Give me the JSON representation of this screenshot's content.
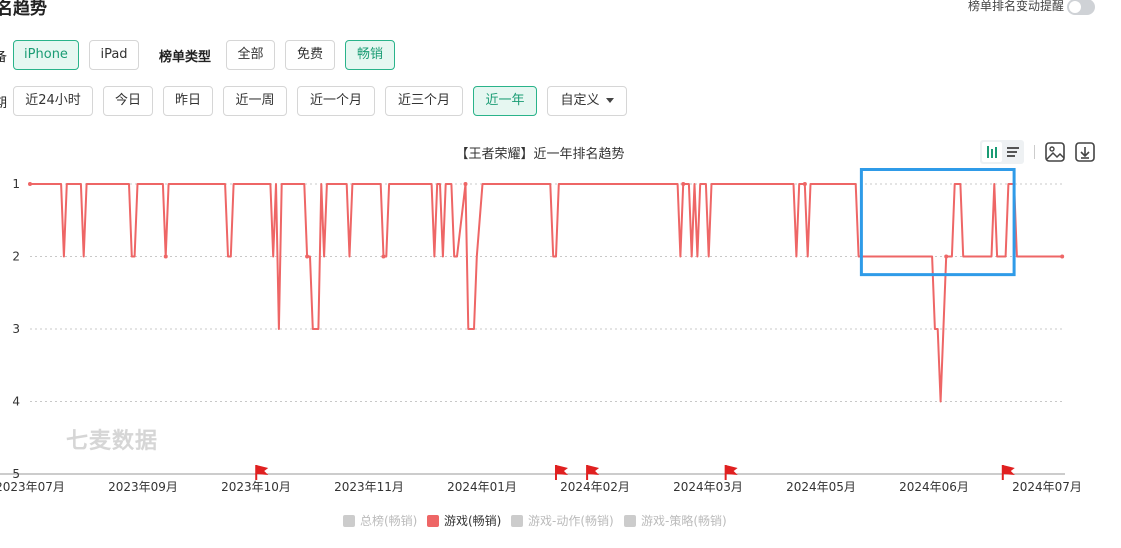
{
  "header": {
    "title": "名趋势",
    "toggle_label": "榜单排名变动提醒"
  },
  "filters": {
    "device_label": "备",
    "device_options": [
      "iPhone",
      "iPad"
    ],
    "device_selected": "iPhone",
    "chart_type_label": "榜单类型",
    "chart_type_options": [
      "全部",
      "免费",
      "畅销"
    ],
    "chart_type_selected": "畅销",
    "time_label": "期",
    "time_options": [
      "近24小时",
      "今日",
      "昨日",
      "近一周",
      "近一个月",
      "近三个月",
      "近一年"
    ],
    "time_selected": "近一年",
    "custom_label": "自定义"
  },
  "chart_data": {
    "type": "line",
    "title": "【王者荣耀】近一年排名趋势",
    "y_axis": {
      "inverted": true,
      "min": 1,
      "max": 5,
      "ticks": [
        "1",
        "2",
        "3",
        "4",
        "5"
      ]
    },
    "x_axis": {
      "range": [
        "2023-07-01",
        "2024-07-01"
      ],
      "tick_labels": [
        "2023年07月",
        "2023年09月",
        "2023年10月",
        "2023年11月",
        "2024年01月",
        "2024年02月",
        "2024年03月",
        "2024年05月",
        "2024年06月",
        "2024年07月"
      ]
    },
    "grid": "horizontal-dotted",
    "legend_position": "bottom",
    "legend": [
      {
        "name": "总榜(畅销)",
        "active": false
      },
      {
        "name": "游戏(畅销)",
        "active": true
      },
      {
        "name": "游戏-动作(畅销)",
        "active": false
      },
      {
        "name": "游戏-策略(畅销)",
        "active": false
      }
    ],
    "series": [
      {
        "name": "游戏(畅销)",
        "color": "#ee6666",
        "points": [
          [
            "2023-07-01",
            1
          ],
          [
            "2023-07-12",
            1
          ],
          [
            "2023-07-13",
            2
          ],
          [
            "2023-07-14",
            1
          ],
          [
            "2023-07-19",
            1
          ],
          [
            "2023-07-20",
            2
          ],
          [
            "2023-07-21",
            1
          ],
          [
            "2023-08-05",
            1
          ],
          [
            "2023-08-06",
            2
          ],
          [
            "2023-08-07",
            2
          ],
          [
            "2023-08-08",
            1
          ],
          [
            "2023-08-17",
            1
          ],
          [
            "2023-08-18",
            2
          ],
          [
            "2023-08-19",
            1
          ],
          [
            "2023-09-08",
            1
          ],
          [
            "2023-09-09",
            2
          ],
          [
            "2023-09-10",
            2
          ],
          [
            "2023-09-11",
            1
          ],
          [
            "2023-09-24",
            1
          ],
          [
            "2023-09-25",
            2
          ],
          [
            "2023-09-26",
            1
          ],
          [
            "2023-09-27",
            3
          ],
          [
            "2023-09-28",
            1
          ],
          [
            "2023-10-06",
            1
          ],
          [
            "2023-10-07",
            2
          ],
          [
            "2023-10-08",
            2
          ],
          [
            "2023-10-09",
            3
          ],
          [
            "2023-10-10",
            3
          ],
          [
            "2023-10-11",
            3
          ],
          [
            "2023-10-12",
            1
          ],
          [
            "2023-10-13",
            2
          ],
          [
            "2023-10-14",
            1
          ],
          [
            "2023-10-21",
            1
          ],
          [
            "2023-10-22",
            2
          ],
          [
            "2023-10-23",
            1
          ],
          [
            "2023-11-02",
            1
          ],
          [
            "2023-11-03",
            2
          ],
          [
            "2023-11-04",
            2
          ],
          [
            "2023-11-05",
            1
          ],
          [
            "2023-11-20",
            1
          ],
          [
            "2023-11-21",
            2
          ],
          [
            "2023-11-22",
            1
          ],
          [
            "2023-11-23",
            1
          ],
          [
            "2023-11-24",
            2
          ],
          [
            "2023-11-25",
            1
          ],
          [
            "2023-11-27",
            1
          ],
          [
            "2023-11-28",
            2
          ],
          [
            "2023-11-29",
            2
          ],
          [
            "2023-12-02",
            1
          ],
          [
            "2023-12-03",
            3
          ],
          [
            "2023-12-04",
            3
          ],
          [
            "2023-12-05",
            3
          ],
          [
            "2023-12-06",
            2
          ],
          [
            "2023-12-08",
            1
          ],
          [
            "2024-01-01",
            1
          ],
          [
            "2024-01-02",
            2
          ],
          [
            "2024-01-03",
            2
          ],
          [
            "2024-01-04",
            1
          ],
          [
            "2024-02-15",
            1
          ],
          [
            "2024-02-16",
            2
          ],
          [
            "2024-02-17",
            1
          ],
          [
            "2024-02-19",
            1
          ],
          [
            "2024-02-20",
            2
          ],
          [
            "2024-02-21",
            1
          ],
          [
            "2024-02-22",
            2
          ],
          [
            "2024-02-23",
            1
          ],
          [
            "2024-02-25",
            1
          ],
          [
            "2024-02-26",
            2
          ],
          [
            "2024-02-27",
            1
          ],
          [
            "2024-03-27",
            1
          ],
          [
            "2024-03-28",
            2
          ],
          [
            "2024-03-29",
            1
          ],
          [
            "2024-03-31",
            1
          ],
          [
            "2024-04-01",
            2
          ],
          [
            "2024-04-02",
            1
          ],
          [
            "2024-04-18",
            1
          ],
          [
            "2024-04-19",
            2
          ],
          [
            "2024-04-20",
            2
          ],
          [
            "2024-05-07",
            2
          ],
          [
            "2024-05-15",
            2
          ],
          [
            "2024-05-16",
            3
          ],
          [
            "2024-05-17",
            3
          ],
          [
            "2024-05-18",
            4
          ],
          [
            "2024-05-19",
            3
          ],
          [
            "2024-05-20",
            2
          ],
          [
            "2024-05-22",
            2
          ],
          [
            "2024-05-23",
            1
          ],
          [
            "2024-05-25",
            1
          ],
          [
            "2024-05-26",
            2
          ],
          [
            "2024-06-05",
            2
          ],
          [
            "2024-06-06",
            1
          ],
          [
            "2024-06-07",
            2
          ],
          [
            "2024-06-10",
            2
          ],
          [
            "2024-06-11",
            1
          ],
          [
            "2024-06-13",
            1
          ],
          [
            "2024-06-14",
            2
          ],
          [
            "2024-06-30",
            2
          ]
        ]
      }
    ],
    "event_flags": [
      "2023-09-19",
      "2024-01-03",
      "2024-01-14",
      "2024-03-03",
      "2024-06-09"
    ],
    "highlight_range": {
      "x": [
        "2024-04-20",
        "2024-06-13"
      ],
      "y": [
        0.8,
        2.25
      ]
    }
  },
  "watermark": "七麦数据"
}
